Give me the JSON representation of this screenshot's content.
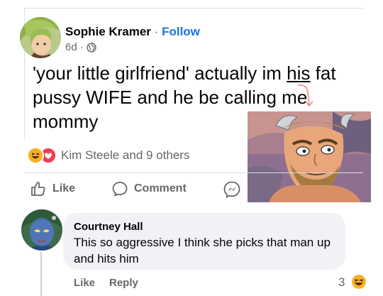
{
  "post": {
    "author_name": "Sophie Kramer",
    "separator": "·",
    "follow_label": "Follow",
    "time": "6d",
    "meta_separator": "·",
    "text_before": "'your little girlfriend' actually im ",
    "text_underlined": "his",
    "text_after": " fat pussy WIFE and he be calling me mommy",
    "reaction_summary": "Kim Steele and 9 others",
    "actions": {
      "like": "Like",
      "comment": "Comment"
    },
    "reaction_icons": [
      "haha-icon",
      "love-icon"
    ]
  },
  "comment": {
    "author_name": "Courtney Hall",
    "text": "This so aggressive I think she picks that man up and hits him",
    "like_label": "Like",
    "reply_label": "Reply",
    "reaction_count": "3",
    "reaction_icon": "haha-icon"
  },
  "colors": {
    "link_blue": "#1b74e4",
    "secondary_text": "#65676b",
    "bubble_bg": "#f0f2f5",
    "love_red": "#f33e58",
    "haha_yellow": "#f7b125"
  }
}
